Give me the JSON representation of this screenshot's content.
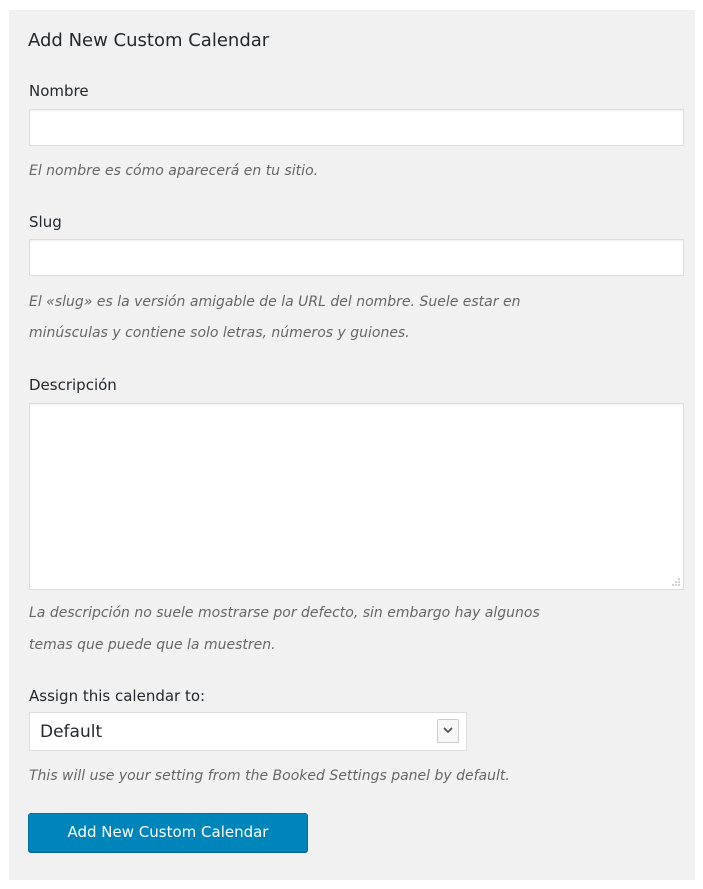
{
  "form": {
    "title": "Add New Custom Calendar",
    "name": {
      "label": "Nombre",
      "value": "",
      "help": "El nombre es cómo aparecerá en tu sitio."
    },
    "slug": {
      "label": "Slug",
      "value": "",
      "help_line1": "El «slug» es la versión amigable de la URL del nombre. Suele estar en",
      "help_line2": "minúsculas y contiene solo letras, números y guiones."
    },
    "description": {
      "label": "Descripción",
      "value": "",
      "help_line1": "La descripción no suele mostrarse por defecto, sin embargo hay algunos",
      "help_line2": "temas que puede que la muestren."
    },
    "assign": {
      "label": "Assign this calendar to:",
      "selected": "Default",
      "help": "This will use your setting from the Booked Settings panel by default."
    },
    "submit_label": "Add New Custom Calendar"
  },
  "icons": {
    "select_arrow": "chevron-down-icon",
    "resize": "resize-handle-icon"
  },
  "colors": {
    "panel_bg": "#f1f1f1",
    "button_bg": "#0085ba",
    "help_text": "#666666"
  }
}
